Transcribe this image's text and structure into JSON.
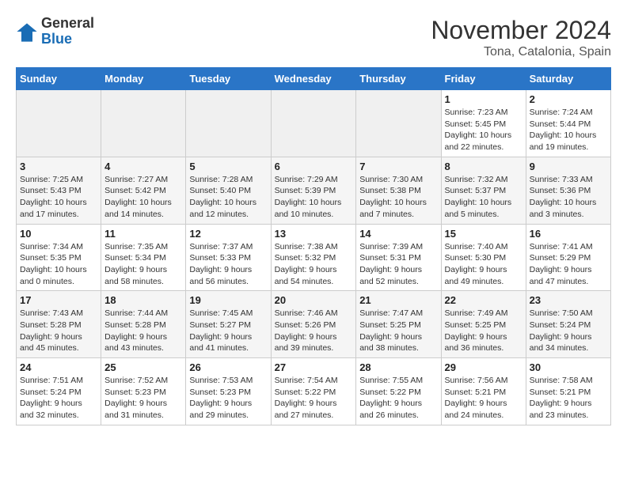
{
  "logo": {
    "general": "General",
    "blue": "Blue"
  },
  "title": "November 2024",
  "location": "Tona, Catalonia, Spain",
  "weekdays": [
    "Sunday",
    "Monday",
    "Tuesday",
    "Wednesday",
    "Thursday",
    "Friday",
    "Saturday"
  ],
  "weeks": [
    [
      {
        "day": "",
        "sunrise": "",
        "sunset": "",
        "daylight": ""
      },
      {
        "day": "",
        "sunrise": "",
        "sunset": "",
        "daylight": ""
      },
      {
        "day": "",
        "sunrise": "",
        "sunset": "",
        "daylight": ""
      },
      {
        "day": "",
        "sunrise": "",
        "sunset": "",
        "daylight": ""
      },
      {
        "day": "",
        "sunrise": "",
        "sunset": "",
        "daylight": ""
      },
      {
        "day": "1",
        "sunrise": "Sunrise: 7:23 AM",
        "sunset": "Sunset: 5:45 PM",
        "daylight": "Daylight: 10 hours and 22 minutes."
      },
      {
        "day": "2",
        "sunrise": "Sunrise: 7:24 AM",
        "sunset": "Sunset: 5:44 PM",
        "daylight": "Daylight: 10 hours and 19 minutes."
      }
    ],
    [
      {
        "day": "3",
        "sunrise": "Sunrise: 7:25 AM",
        "sunset": "Sunset: 5:43 PM",
        "daylight": "Daylight: 10 hours and 17 minutes."
      },
      {
        "day": "4",
        "sunrise": "Sunrise: 7:27 AM",
        "sunset": "Sunset: 5:42 PM",
        "daylight": "Daylight: 10 hours and 14 minutes."
      },
      {
        "day": "5",
        "sunrise": "Sunrise: 7:28 AM",
        "sunset": "Sunset: 5:40 PM",
        "daylight": "Daylight: 10 hours and 12 minutes."
      },
      {
        "day": "6",
        "sunrise": "Sunrise: 7:29 AM",
        "sunset": "Sunset: 5:39 PM",
        "daylight": "Daylight: 10 hours and 10 minutes."
      },
      {
        "day": "7",
        "sunrise": "Sunrise: 7:30 AM",
        "sunset": "Sunset: 5:38 PM",
        "daylight": "Daylight: 10 hours and 7 minutes."
      },
      {
        "day": "8",
        "sunrise": "Sunrise: 7:32 AM",
        "sunset": "Sunset: 5:37 PM",
        "daylight": "Daylight: 10 hours and 5 minutes."
      },
      {
        "day": "9",
        "sunrise": "Sunrise: 7:33 AM",
        "sunset": "Sunset: 5:36 PM",
        "daylight": "Daylight: 10 hours and 3 minutes."
      }
    ],
    [
      {
        "day": "10",
        "sunrise": "Sunrise: 7:34 AM",
        "sunset": "Sunset: 5:35 PM",
        "daylight": "Daylight: 10 hours and 0 minutes."
      },
      {
        "day": "11",
        "sunrise": "Sunrise: 7:35 AM",
        "sunset": "Sunset: 5:34 PM",
        "daylight": "Daylight: 9 hours and 58 minutes."
      },
      {
        "day": "12",
        "sunrise": "Sunrise: 7:37 AM",
        "sunset": "Sunset: 5:33 PM",
        "daylight": "Daylight: 9 hours and 56 minutes."
      },
      {
        "day": "13",
        "sunrise": "Sunrise: 7:38 AM",
        "sunset": "Sunset: 5:32 PM",
        "daylight": "Daylight: 9 hours and 54 minutes."
      },
      {
        "day": "14",
        "sunrise": "Sunrise: 7:39 AM",
        "sunset": "Sunset: 5:31 PM",
        "daylight": "Daylight: 9 hours and 52 minutes."
      },
      {
        "day": "15",
        "sunrise": "Sunrise: 7:40 AM",
        "sunset": "Sunset: 5:30 PM",
        "daylight": "Daylight: 9 hours and 49 minutes."
      },
      {
        "day": "16",
        "sunrise": "Sunrise: 7:41 AM",
        "sunset": "Sunset: 5:29 PM",
        "daylight": "Daylight: 9 hours and 47 minutes."
      }
    ],
    [
      {
        "day": "17",
        "sunrise": "Sunrise: 7:43 AM",
        "sunset": "Sunset: 5:28 PM",
        "daylight": "Daylight: 9 hours and 45 minutes."
      },
      {
        "day": "18",
        "sunrise": "Sunrise: 7:44 AM",
        "sunset": "Sunset: 5:28 PM",
        "daylight": "Daylight: 9 hours and 43 minutes."
      },
      {
        "day": "19",
        "sunrise": "Sunrise: 7:45 AM",
        "sunset": "Sunset: 5:27 PM",
        "daylight": "Daylight: 9 hours and 41 minutes."
      },
      {
        "day": "20",
        "sunrise": "Sunrise: 7:46 AM",
        "sunset": "Sunset: 5:26 PM",
        "daylight": "Daylight: 9 hours and 39 minutes."
      },
      {
        "day": "21",
        "sunrise": "Sunrise: 7:47 AM",
        "sunset": "Sunset: 5:25 PM",
        "daylight": "Daylight: 9 hours and 38 minutes."
      },
      {
        "day": "22",
        "sunrise": "Sunrise: 7:49 AM",
        "sunset": "Sunset: 5:25 PM",
        "daylight": "Daylight: 9 hours and 36 minutes."
      },
      {
        "day": "23",
        "sunrise": "Sunrise: 7:50 AM",
        "sunset": "Sunset: 5:24 PM",
        "daylight": "Daylight: 9 hours and 34 minutes."
      }
    ],
    [
      {
        "day": "24",
        "sunrise": "Sunrise: 7:51 AM",
        "sunset": "Sunset: 5:24 PM",
        "daylight": "Daylight: 9 hours and 32 minutes."
      },
      {
        "day": "25",
        "sunrise": "Sunrise: 7:52 AM",
        "sunset": "Sunset: 5:23 PM",
        "daylight": "Daylight: 9 hours and 31 minutes."
      },
      {
        "day": "26",
        "sunrise": "Sunrise: 7:53 AM",
        "sunset": "Sunset: 5:23 PM",
        "daylight": "Daylight: 9 hours and 29 minutes."
      },
      {
        "day": "27",
        "sunrise": "Sunrise: 7:54 AM",
        "sunset": "Sunset: 5:22 PM",
        "daylight": "Daylight: 9 hours and 27 minutes."
      },
      {
        "day": "28",
        "sunrise": "Sunrise: 7:55 AM",
        "sunset": "Sunset: 5:22 PM",
        "daylight": "Daylight: 9 hours and 26 minutes."
      },
      {
        "day": "29",
        "sunrise": "Sunrise: 7:56 AM",
        "sunset": "Sunset: 5:21 PM",
        "daylight": "Daylight: 9 hours and 24 minutes."
      },
      {
        "day": "30",
        "sunrise": "Sunrise: 7:58 AM",
        "sunset": "Sunset: 5:21 PM",
        "daylight": "Daylight: 9 hours and 23 minutes."
      }
    ]
  ]
}
